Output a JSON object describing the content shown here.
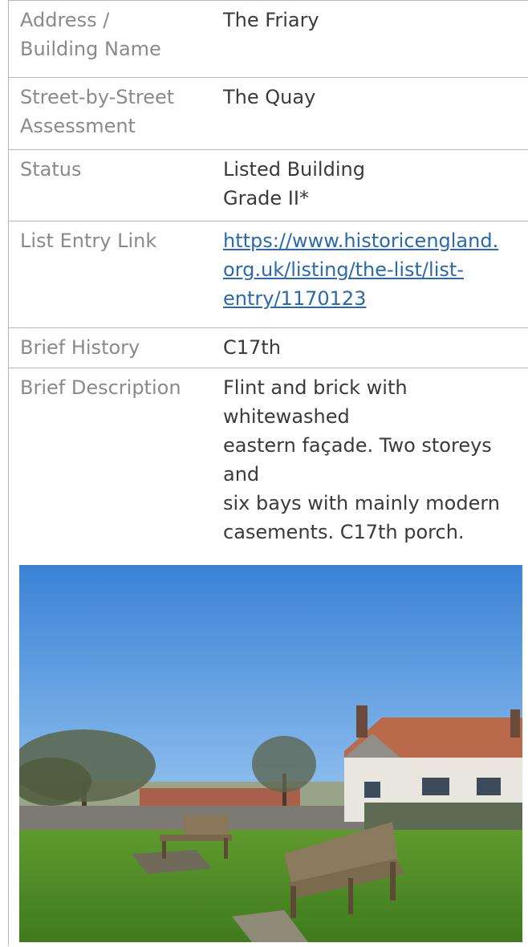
{
  "rows": [
    {
      "label_lines": [
        "Address /",
        "Building Name"
      ],
      "value_lines": [
        "The Friary"
      ]
    },
    {
      "label_lines": [
        "Street-by-Street",
        "Assessment"
      ],
      "value_lines": [
        "The Quay"
      ]
    },
    {
      "label_lines": [
        "Status"
      ],
      "value_lines": [
        "Listed Building",
        "Grade II*"
      ]
    },
    {
      "label_lines": [
        "List Entry Link"
      ],
      "value_lines": [
        "https://www.historicengland.",
        "org.uk/listing/the-list/list-",
        "entry/1170123"
      ]
    },
    {
      "label_lines": [
        "Brief History"
      ],
      "value_lines": [
        "C17th"
      ]
    },
    {
      "label_lines": [
        "Brief Description"
      ],
      "value_lines": [
        "Flint and brick with whitewashed",
        "eastern façade. Two storeys and",
        "six bays with mainly modern",
        "casements. C17th porch."
      ]
    }
  ],
  "colors": {
    "label": "#8a8a8a",
    "value": "#3a3a3a",
    "link": "#2a69b0",
    "border": "#b8b8b8"
  },
  "photo": {
    "subject": "photo-building-with-benches"
  }
}
